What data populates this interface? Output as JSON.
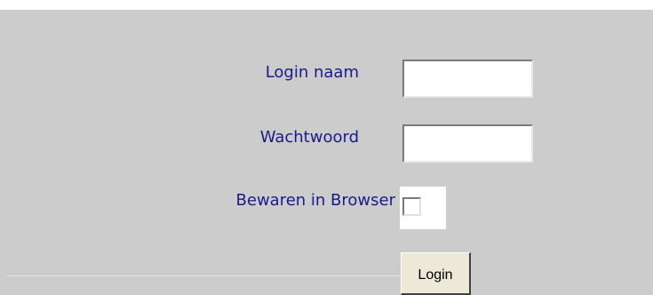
{
  "form": {
    "login_name_label": "Login naam",
    "login_name_value": "",
    "password_label": "Wachtwoord",
    "password_value": "",
    "remember_label": "Bewaren in Browser",
    "remember_checked": false,
    "submit_label": "Login"
  },
  "colors": {
    "panel_background": "#cccccc",
    "label_text": "#1a1a8c",
    "button_face": "#ece9d8"
  }
}
